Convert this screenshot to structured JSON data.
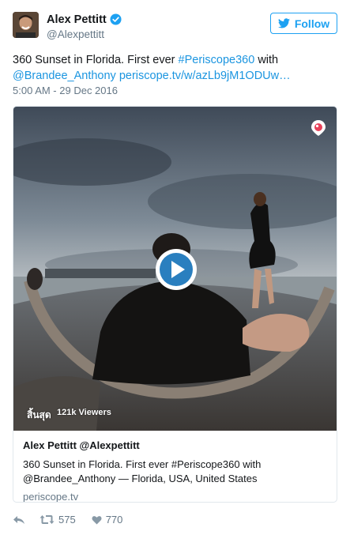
{
  "author": {
    "name": "Alex Pettitt",
    "handle": "@Alexpettitt",
    "verified": true
  },
  "follow_button": {
    "label": "Follow",
    "icon": "twitter-bird-icon"
  },
  "tweet": {
    "text_plain": "360 Sunset in Florida. First ever ",
    "hashtag": "#Periscope360",
    "text_with": " with",
    "mention": "@Brandee_Anthony",
    "url": "periscope.tv/w/azLb9jM1ODUw…",
    "timestamp": "5:00 AM - 29 Dec 2016"
  },
  "card": {
    "live_label": "สิ้นสุด",
    "viewers": "121k Viewers",
    "title": "Alex Pettitt @Alexpettitt",
    "description": "360 Sunset in Florida. First ever #Periscope360 with @Brandee_Anthony — Florida, USA, United States",
    "domain": "periscope.tv"
  },
  "actions": {
    "reply_icon": "reply-icon",
    "retweet_icon": "retweet-icon",
    "retweet_count": "575",
    "like_icon": "heart-icon",
    "like_count": "770"
  },
  "colors": {
    "accent": "#1da1f2",
    "link": "#1b95e0",
    "muted": "#657786",
    "play_button": "#2a7fbf"
  }
}
